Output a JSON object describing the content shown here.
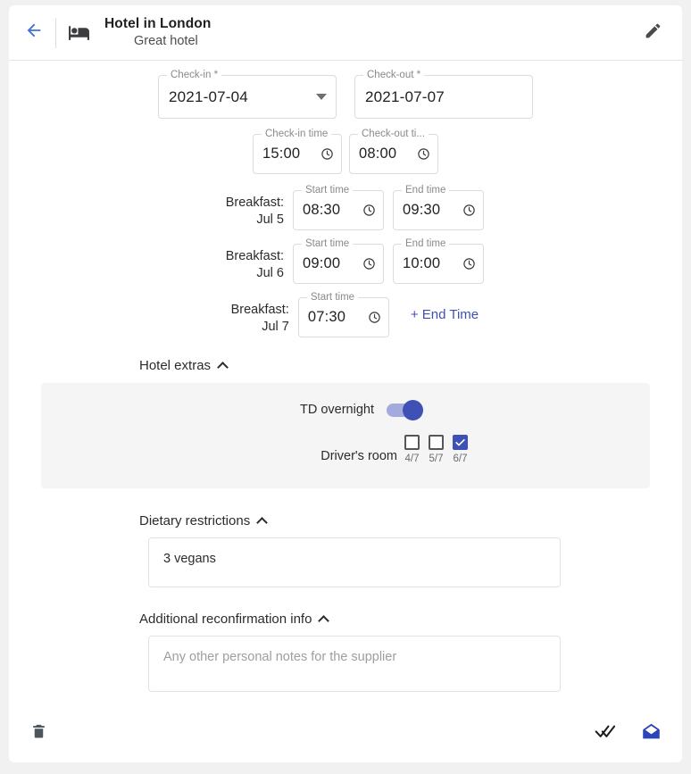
{
  "header": {
    "back_icon": "arrow-left-icon",
    "hotel_icon": "hotel-bed-icon",
    "title": "Hotel in London",
    "subtitle": "Great hotel",
    "edit_icon": "pencil-edit-icon"
  },
  "dates": {
    "checkin": {
      "label": "Check-in *",
      "value": "2021-07-04",
      "dropdown_icon": "caret-down-icon"
    },
    "checkout": {
      "label": "Check-out *",
      "value": "2021-07-07"
    }
  },
  "times": {
    "checkin_time": {
      "label": "Check-in time",
      "value": "15:00",
      "icon": "clock-icon"
    },
    "checkout_time": {
      "label": "Check-out ti...",
      "value": "08:00",
      "icon": "clock-icon"
    }
  },
  "breakfasts": [
    {
      "label": "Breakfast:",
      "date": "Jul 5",
      "start": {
        "label": "Start time",
        "value": "08:30"
      },
      "end": {
        "label": "End time",
        "value": "09:30"
      }
    },
    {
      "label": "Breakfast:",
      "date": "Jul 6",
      "start": {
        "label": "Start time",
        "value": "09:00"
      },
      "end": {
        "label": "End time",
        "value": "10:00"
      }
    },
    {
      "label": "Breakfast:",
      "date": "Jul 7",
      "start": {
        "label": "Start time",
        "value": "07:30"
      },
      "add_end_label": "+ End Time"
    }
  ],
  "hotel_extras": {
    "section_title": "Hotel extras",
    "collapse_icon": "chevron-up-icon",
    "td_overnight": {
      "label": "TD overnight",
      "on": true
    },
    "drivers_room": {
      "label": "Driver's room",
      "options": [
        {
          "caption": "4/7",
          "checked": false
        },
        {
          "caption": "5/7",
          "checked": false
        },
        {
          "caption": "6/7",
          "checked": true
        }
      ]
    }
  },
  "dietary": {
    "section_title": "Dietary restrictions",
    "collapse_icon": "chevron-up-icon",
    "value": "3 vegans"
  },
  "additional": {
    "section_title": "Additional reconfirmation info",
    "collapse_icon": "chevron-up-icon",
    "placeholder": "Any other personal notes for the supplier",
    "value": ""
  },
  "footer": {
    "delete_icon": "trash-delete-icon",
    "confirm_icon": "double-check-icon",
    "email_icon": "open-envelope-icon"
  },
  "colors": {
    "accent": "#3f51b5",
    "link": "#3f51b5",
    "page_bg": "#f1f1f1",
    "panel_bg": "#f5f5f5",
    "text": "#2b2b2d"
  }
}
